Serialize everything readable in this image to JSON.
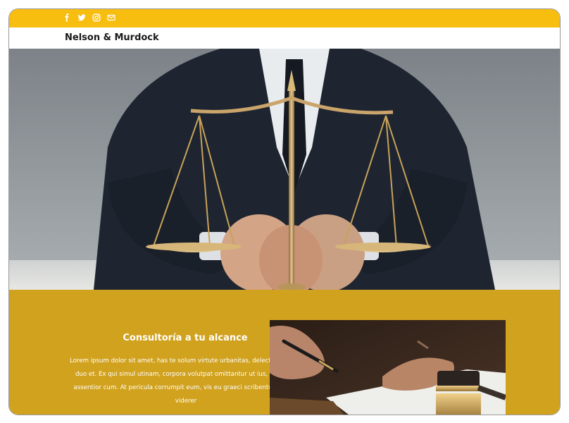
{
  "header": {
    "social_icons": [
      "facebook-icon",
      "twitter-icon",
      "instagram-icon",
      "mail-icon"
    ],
    "brand": "Nelson & Murdock"
  },
  "hero": {
    "image": "lawyer with scales of justice"
  },
  "section": {
    "title": "Consultoría a tu alcance",
    "body": "Lorem ipsum dolor sit amet, has te solum virtute urbanitas, delectus facilisis duo et. Ex qui simul utinam, corpora volutpat omittantur ut ius, eu probo assentior cum. At pericula corrumpit eum, vis eu graeci scribentur. Assum viderer",
    "image": "gavel and signing pen"
  },
  "colors": {
    "topbar": "#f7bd0f",
    "band": "#d1a21e",
    "text_on_band": "#ffffff",
    "brand_text": "#1a1a1a"
  }
}
